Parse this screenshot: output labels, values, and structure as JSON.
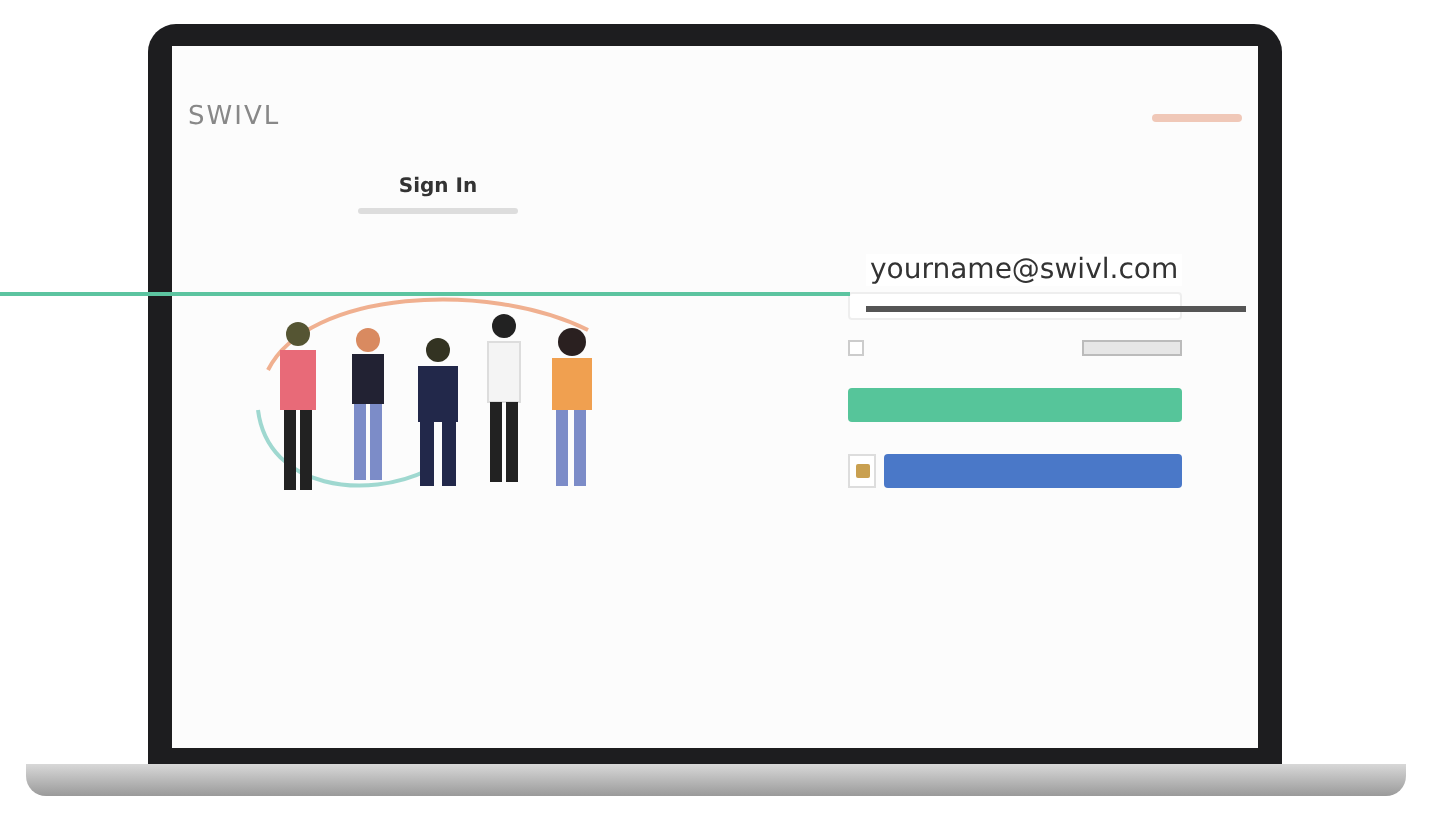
{
  "screen": {
    "logo": "SWIVL",
    "title": "Sign In"
  },
  "remember": {
    "checked": false
  },
  "callout": {
    "text": "yourname@swivl.com"
  }
}
